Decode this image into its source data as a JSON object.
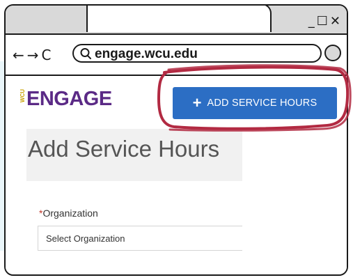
{
  "browser": {
    "window_controls": "_☐✕",
    "nav_buttons": "←→C",
    "url": "engage.wcu.edu"
  },
  "site": {
    "logo_prefix": "WCU",
    "logo_text": "ENGAGE",
    "add_button_label": "ADD SERVICE HOURS",
    "add_button_icon": "plus-icon"
  },
  "page": {
    "title": "Add Service Hours",
    "form": {
      "required_marker": "*",
      "organization_label": "Organization",
      "organization_value": "Select Organization"
    }
  },
  "colors": {
    "brand_purple": "#5b2a86",
    "button_blue": "#2c6ec4",
    "highlight_red": "#b22a42",
    "titlebar_gray": "#d9d9d9",
    "side_band": "#eaf6fa"
  }
}
